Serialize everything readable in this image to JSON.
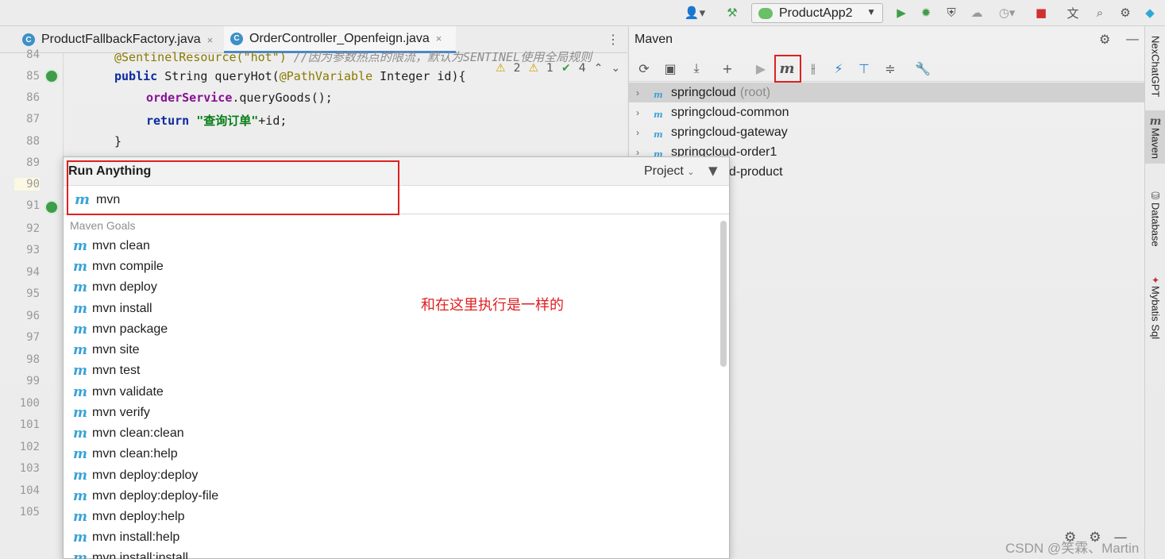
{
  "toolbar": {
    "run_config": "ProductApp2"
  },
  "editor": {
    "tabs": [
      {
        "label": "ProductFallbackFactory.java",
        "icon": "c-class-icon",
        "close": "×"
      },
      {
        "label": "OrderController_Openfeign.java",
        "icon": "c-class-icon",
        "close": "×"
      }
    ],
    "line_numbers": [
      "84",
      "85",
      "86",
      "87",
      "88",
      "89",
      "90",
      "91",
      "92",
      "93",
      "94",
      "95",
      "96",
      "97",
      "98",
      "99",
      "100",
      "101",
      "102",
      "103",
      "104",
      "105"
    ],
    "current_line": "90",
    "code": {
      "l84_ann": "@SentinelResource(\"hot\")",
      "l84_cmt": " //因为参数热点的限流，默认为SENTINEL使用全局规则",
      "l85_kw1": "public",
      "l85_type": " String queryHot(",
      "l85_ann": "@PathVariable",
      "l85_rest": " Integer id){",
      "l86_field": "orderService",
      "l86_rest": ".queryGoods();",
      "l87_kw": "return",
      "l87_str": " \"查询订单\"",
      "l87_rest": "+id;",
      "l88": "}"
    },
    "inspections": {
      "warnings": "2",
      "weak_warnings": "1",
      "ok": "4"
    }
  },
  "maven": {
    "title": "Maven",
    "tree": [
      {
        "label": "springcloud",
        "suffix": "(root)"
      },
      {
        "label": "springcloud-common",
        "suffix": ""
      },
      {
        "label": "springcloud-gateway",
        "suffix": ""
      },
      {
        "label": "springcloud-order1",
        "suffix": ""
      },
      {
        "label": "springcloud-product",
        "suffix": ""
      }
    ]
  },
  "sidebar": {
    "tabs": [
      "NexChatGPT",
      "Maven",
      "Database",
      "Mybatis Sql"
    ]
  },
  "run_anything": {
    "title": "Run Anything",
    "scope": "Project",
    "input_value": "mvn",
    "section": "Maven Goals",
    "goals": [
      "mvn clean",
      "mvn compile",
      "mvn deploy",
      "mvn install",
      "mvn package",
      "mvn site",
      "mvn test",
      "mvn validate",
      "mvn verify",
      "mvn clean:clean",
      "mvn clean:help",
      "mvn deploy:deploy",
      "mvn deploy:deploy-file",
      "mvn deploy:help",
      "mvn install:help",
      "mvn install:install"
    ]
  },
  "annotation_text": "和在这里执行是一样的",
  "watermark": "CSDN @笑霖、Martin",
  "colors": {
    "accent": "#4a88c7",
    "maven_blue": "#3aa3d8",
    "annotation_red": "#e02020"
  }
}
